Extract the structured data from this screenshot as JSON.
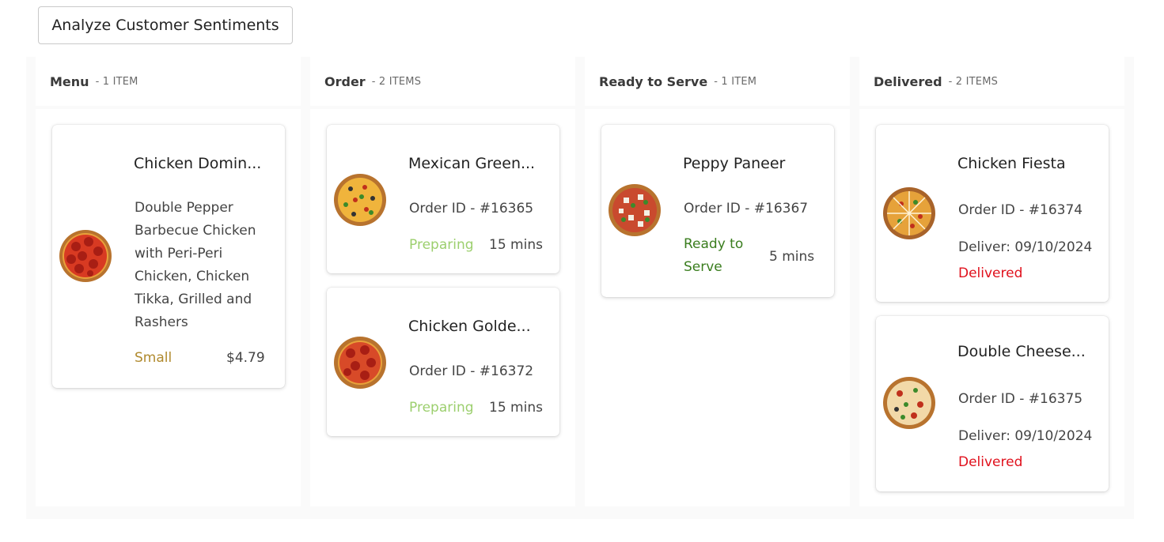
{
  "toolbar": {
    "analyze_label": "Analyze Customer Sentiments"
  },
  "columns": [
    {
      "title": "Menu",
      "count": "- 1 ITEM"
    },
    {
      "title": "Order",
      "count": "- 2 ITEMS"
    },
    {
      "title": "Ready to Serve",
      "count": "- 1 ITEM"
    },
    {
      "title": "Delivered",
      "count": "- 2 ITEMS"
    }
  ],
  "menu": {
    "items": [
      {
        "title": "Chicken Domin...",
        "description": "Double Pepper Barbecue Chicken with Peri-Peri Chicken, Chicken Tikka, Grilled and Rashers",
        "size": "Small",
        "price": "$4.79",
        "image": "pepperoni-pizza-image"
      }
    ]
  },
  "order": {
    "items": [
      {
        "title": "Mexican Green...",
        "order_id": "Order ID - #16365",
        "status": "Preparing",
        "time": "15 mins",
        "image": "veggie-pizza-image"
      },
      {
        "title": "Chicken Golde...",
        "order_id": "Order ID - #16372",
        "status": "Preparing",
        "time": "15 mins",
        "image": "pepperoni-pizza-image"
      }
    ]
  },
  "ready": {
    "items": [
      {
        "title": "Peppy Paneer",
        "order_id": "Order ID - #16367",
        "status": "Ready to Serve",
        "time": "5 mins",
        "image": "paneer-pizza-image"
      }
    ]
  },
  "delivered": {
    "items": [
      {
        "title": "Chicken Fiesta",
        "order_id": "Order ID - #16374",
        "deliver": "Deliver: 09/10/2024",
        "status": "Delivered",
        "image": "sliced-pizza-image"
      },
      {
        "title": "Double Cheese...",
        "order_id": "Order ID - #16375",
        "deliver": "Deliver: 09/10/2024",
        "status": "Delivered",
        "image": "cheese-pizza-image"
      }
    ]
  },
  "colors": {
    "preparing": "#9ccf6e",
    "ready": "#3a7d1e",
    "delivered": "#e0101c",
    "size": "#b08a2e"
  }
}
